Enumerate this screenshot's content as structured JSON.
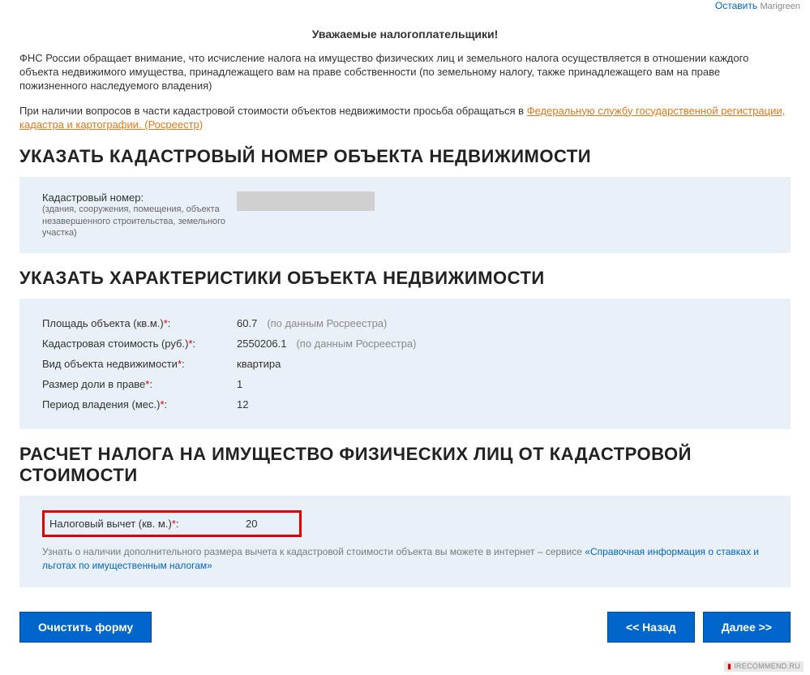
{
  "topRight": {
    "leave": "Оставить",
    "user": "Marigreen"
  },
  "header": {
    "title": "Уважаемые налогоплательщики!",
    "p1": "ФНС России обращает внимание, что исчисление налога на имущество физических лиц и земельного налога осуществляется в отношении каждого объекта недвижимого имущества, принадлежащего вам на праве собственности (по земельному налогу, также принадлежащего вам на праве пожизненного наследуемого владения)",
    "p2_prefix": "При наличии вопросов в части кадастровой стоимости объектов недвижимости просьба обращаться в ",
    "p2_link": "Федеральную службу государственной регистрации, кадастра и картографии. (Росреестр)"
  },
  "section1": {
    "heading": "УКАЗАТЬ КАДАСТРОВЫЙ НОМЕР ОБЪЕКТА НЕДВИЖИМОСТИ",
    "label": "Кадастровый номер:",
    "hint": "(здания, сооружения, помещения, объекта незавершенного строительства, земельного участка)"
  },
  "section2": {
    "heading": "УКАЗАТЬ ХАРАКТЕРИСТИКИ ОБЪЕКТА НЕДВИЖИМОСТИ",
    "rows": {
      "area_label": "Площадь объекта (кв.м.)",
      "area_val": "60.7",
      "area_note": "(по данным Росреестра)",
      "cost_label": "Кадастровая стоимость (руб.)",
      "cost_val": "2550206.1",
      "cost_note": "(по данным Росреестра)",
      "type_label": "Вид объекта недвижимости",
      "type_val": "квартира",
      "share_label": "Размер доли в праве",
      "share_val": "1",
      "period_label": "Период владения (мес.)",
      "period_val": "12"
    }
  },
  "section3": {
    "heading": "РАСЧЕТ НАЛОГА НА ИМУЩЕСТВО ФИЗИЧЕСКИХ ЛИЦ ОТ КАДАСТРОВОЙ СТОИМОСТИ",
    "deduct_label": "Налоговый вычет (кв. м.)",
    "deduct_val": "20",
    "info_prefix": "Узнать о наличии дополнительного размера вычета к кадастровой стоимости объекта вы можете в интернет – сервисе ",
    "info_link": "«Справочная информация о ставках и льготах по имущественным налогам»"
  },
  "buttons": {
    "clear": "Очистить форму",
    "back": "<< Назад",
    "next": "Далее >>"
  },
  "footer": "IRECOMMEND.RU",
  "star": "*",
  "colon": ":"
}
